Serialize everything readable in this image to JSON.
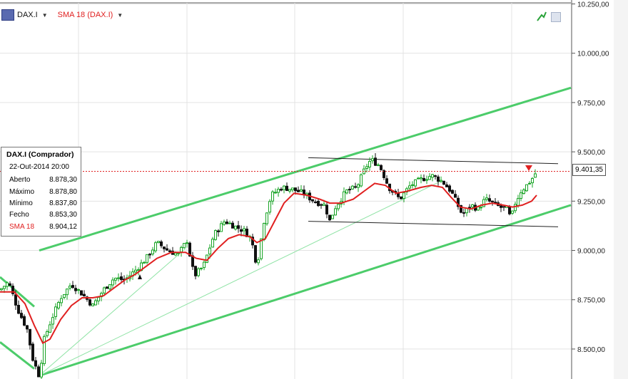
{
  "header": {
    "symbol": "DAX.I",
    "indicator": "SMA 18 (DAX.I)"
  },
  "info": {
    "title": "DAX.I (Comprador)",
    "datetime": "22-Out-2014 20:00",
    "rows": [
      {
        "label": "Aberto",
        "value": "8.878,30"
      },
      {
        "label": "Máximo",
        "value": "8.878,80"
      },
      {
        "label": "Mínimo",
        "value": "8.837,80"
      },
      {
        "label": "Fecho",
        "value": "8.853,30"
      },
      {
        "label": "SMA 18",
        "value": "8.904,12"
      }
    ]
  },
  "last_price_label": "9.401,35",
  "colors": {
    "up": "#17a324",
    "down": "#111111",
    "sma": "#e02020",
    "trend": "#4ccc6a",
    "channel": "#222222",
    "priceLine": "#e02020"
  },
  "chart_data": {
    "type": "line",
    "title": "",
    "xlabel": "",
    "ylabel": "",
    "ylim": [
      8348,
      10270
    ],
    "yticks": [
      {
        "value": 10250,
        "label": "10.250,00"
      },
      {
        "value": 10000,
        "label": "10.000,00"
      },
      {
        "value": 9750,
        "label": "9.750,00"
      },
      {
        "value": 9500,
        "label": "9.500,00"
      },
      {
        "value": 9250,
        "label": "9.250,00"
      },
      {
        "value": 9000,
        "label": "9.000,00"
      },
      {
        "value": 8750,
        "label": "8.750,00"
      },
      {
        "value": 8500,
        "label": "8.500,00"
      }
    ],
    "x_range": [
      0,
      800
    ],
    "series": [
      {
        "name": "DAX.I",
        "points": [
          [
            0,
            8800
          ],
          [
            12,
            8840
          ],
          [
            25,
            8700
          ],
          [
            38,
            8600
          ],
          [
            46,
            8450
          ],
          [
            55,
            8360
          ],
          [
            62,
            8550
          ],
          [
            72,
            8650
          ],
          [
            85,
            8760
          ],
          [
            100,
            8830
          ],
          [
            115,
            8780
          ],
          [
            130,
            8720
          ],
          [
            145,
            8800
          ],
          [
            160,
            8860
          ],
          [
            175,
            8850
          ],
          [
            190,
            8900
          ],
          [
            205,
            8960
          ],
          [
            220,
            9040
          ],
          [
            235,
            9000
          ],
          [
            250,
            8980
          ],
          [
            262,
            9050
          ],
          [
            272,
            8870
          ],
          [
            285,
            8920
          ],
          [
            300,
            9080
          ],
          [
            315,
            9150
          ],
          [
            330,
            9120
          ],
          [
            342,
            9100
          ],
          [
            352,
            9060
          ],
          [
            360,
            8920
          ],
          [
            370,
            9150
          ],
          [
            380,
            9280
          ],
          [
            395,
            9320
          ],
          [
            410,
            9310
          ],
          [
            425,
            9290
          ],
          [
            440,
            9250
          ],
          [
            455,
            9230
          ],
          [
            462,
            9150
          ],
          [
            470,
            9220
          ],
          [
            485,
            9300
          ],
          [
            500,
            9320
          ],
          [
            512,
            9420
          ],
          [
            520,
            9460
          ],
          [
            532,
            9430
          ],
          [
            545,
            9320
          ],
          [
            560,
            9260
          ],
          [
            575,
            9330
          ],
          [
            590,
            9360
          ],
          [
            605,
            9380
          ],
          [
            620,
            9350
          ],
          [
            632,
            9300
          ],
          [
            640,
            9240
          ],
          [
            648,
            9180
          ],
          [
            660,
            9230
          ],
          [
            670,
            9210
          ],
          [
            680,
            9260
          ],
          [
            690,
            9240
          ],
          [
            700,
            9220
          ],
          [
            710,
            9210
          ],
          [
            716,
            9160
          ],
          [
            722,
            9240
          ],
          [
            730,
            9300
          ],
          [
            738,
            9330
          ],
          [
            745,
            9360
          ],
          [
            752,
            9401
          ]
        ]
      },
      {
        "name": "SMA 18 (DAX.I)",
        "points": [
          [
            0,
            8790
          ],
          [
            20,
            8790
          ],
          [
            35,
            8730
          ],
          [
            48,
            8620
          ],
          [
            60,
            8530
          ],
          [
            70,
            8550
          ],
          [
            85,
            8650
          ],
          [
            100,
            8720
          ],
          [
            115,
            8760
          ],
          [
            130,
            8760
          ],
          [
            145,
            8770
          ],
          [
            160,
            8810
          ],
          [
            175,
            8850
          ],
          [
            190,
            8880
          ],
          [
            205,
            8920
          ],
          [
            220,
            8960
          ],
          [
            240,
            8990
          ],
          [
            260,
            8990
          ],
          [
            275,
            8960
          ],
          [
            290,
            8950
          ],
          [
            305,
            9010
          ],
          [
            320,
            9060
          ],
          [
            335,
            9080
          ],
          [
            350,
            9070
          ],
          [
            360,
            9040
          ],
          [
            372,
            9060
          ],
          [
            385,
            9150
          ],
          [
            398,
            9240
          ],
          [
            412,
            9290
          ],
          [
            430,
            9280
          ],
          [
            448,
            9260
          ],
          [
            462,
            9240
          ],
          [
            478,
            9240
          ],
          [
            495,
            9260
          ],
          [
            510,
            9300
          ],
          [
            525,
            9340
          ],
          [
            540,
            9330
          ],
          [
            555,
            9290
          ],
          [
            570,
            9300
          ],
          [
            590,
            9320
          ],
          [
            605,
            9330
          ],
          [
            620,
            9320
          ],
          [
            632,
            9270
          ],
          [
            645,
            9220
          ],
          [
            660,
            9210
          ],
          [
            675,
            9230
          ],
          [
            690,
            9240
          ],
          [
            705,
            9230
          ],
          [
            718,
            9220
          ],
          [
            732,
            9230
          ],
          [
            745,
            9250
          ],
          [
            752,
            9280
          ]
        ]
      }
    ],
    "price_line": 9401.35,
    "grid": true
  }
}
